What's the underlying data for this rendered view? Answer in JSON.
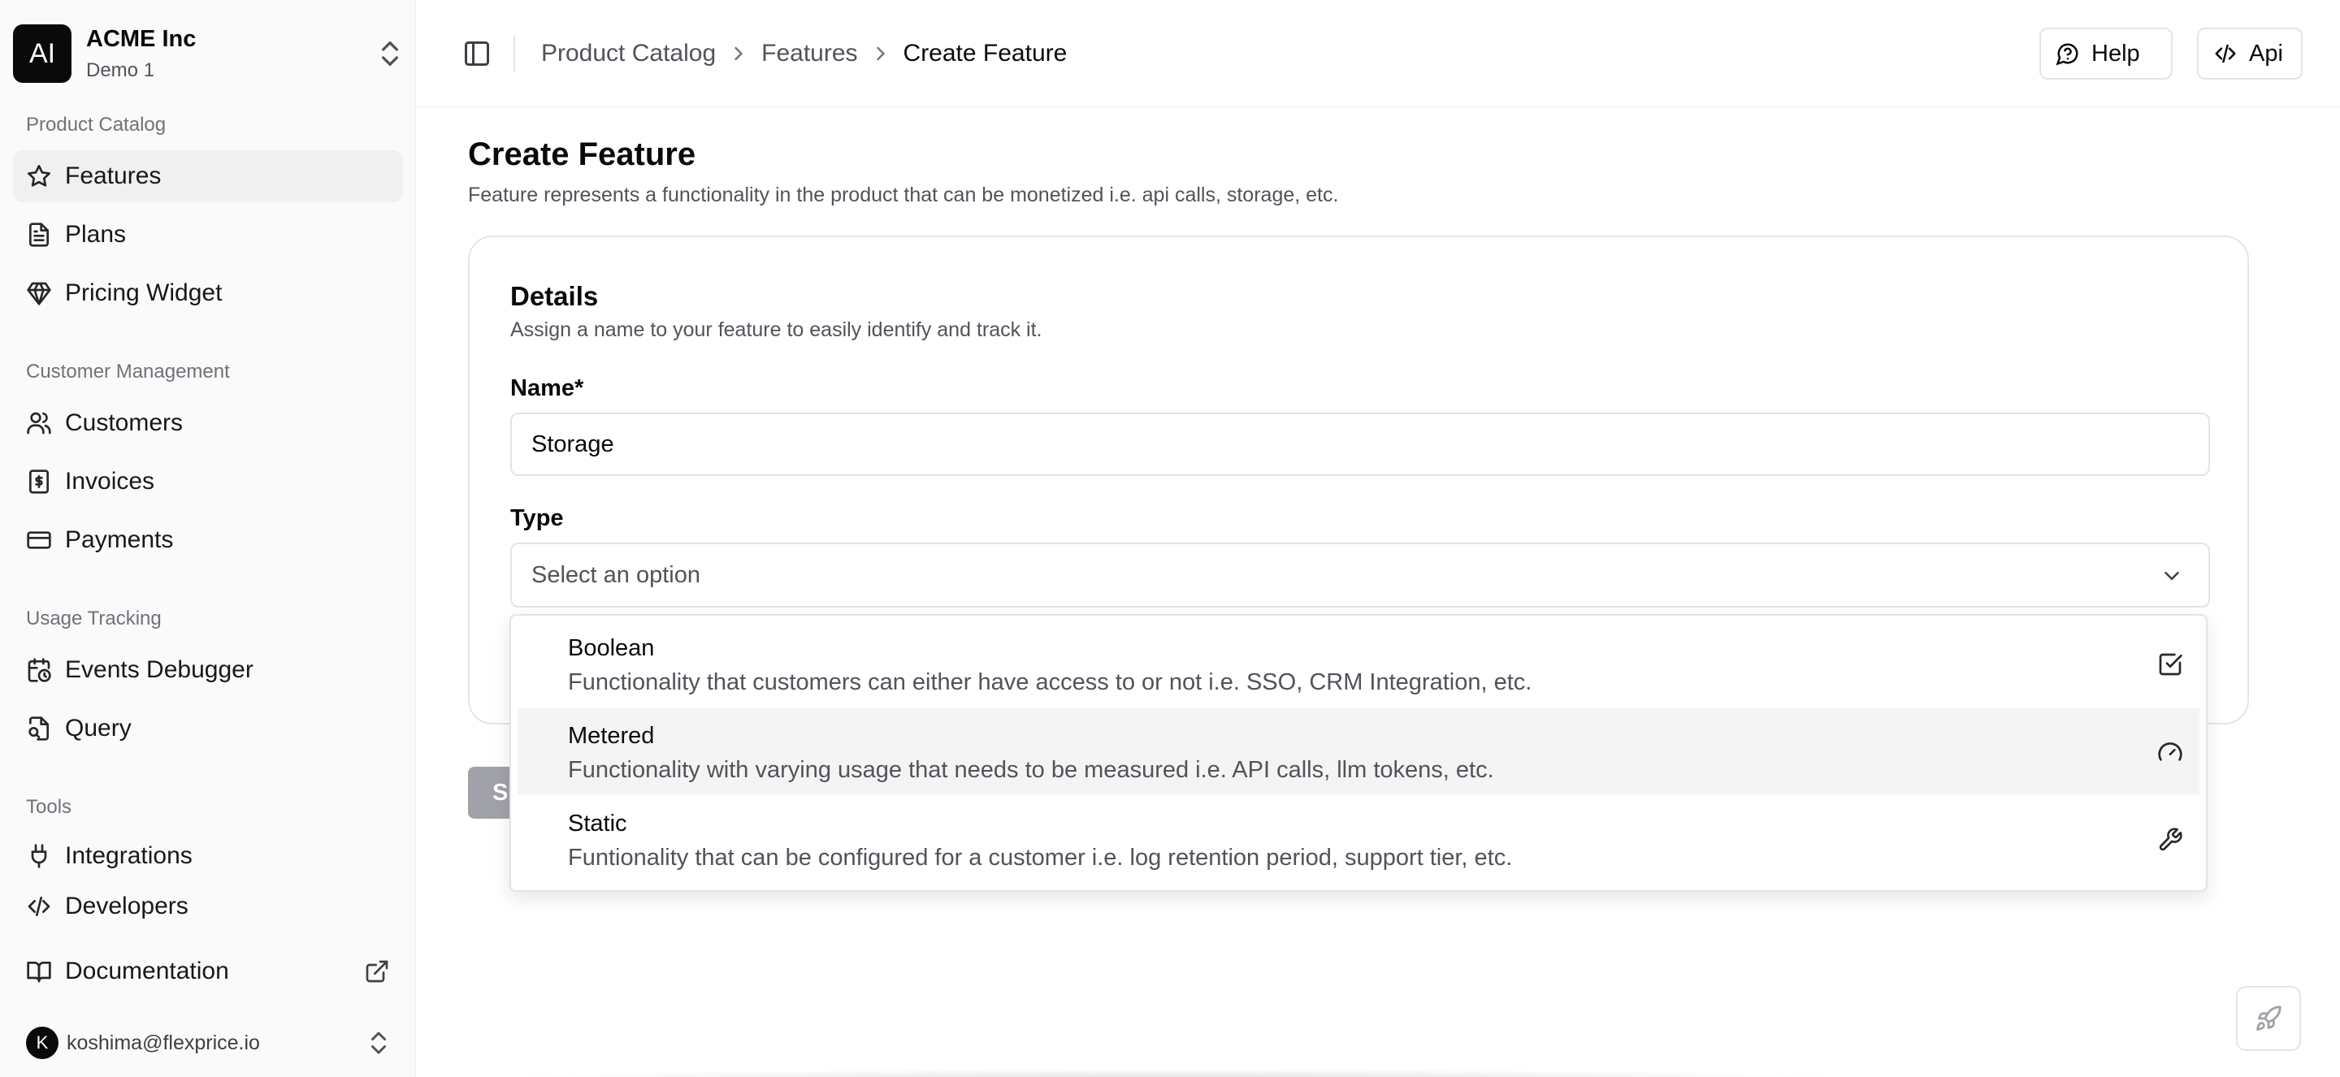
{
  "org": {
    "initials": "AI",
    "name": "ACME Inc",
    "env": "Demo 1"
  },
  "sidebar": {
    "sections": [
      {
        "label": "Product Catalog",
        "items": [
          {
            "label": "Features",
            "icon": "star-icon",
            "active": true
          },
          {
            "label": "Plans",
            "icon": "file-icon"
          },
          {
            "label": "Pricing Widget",
            "icon": "gem-icon"
          }
        ]
      },
      {
        "label": "Customer Management",
        "items": [
          {
            "label": "Customers",
            "icon": "users-icon"
          },
          {
            "label": "Invoices",
            "icon": "receipt-dollar-icon"
          },
          {
            "label": "Payments",
            "icon": "credit-card-icon"
          }
        ]
      },
      {
        "label": "Usage Tracking",
        "items": [
          {
            "label": "Events Debugger",
            "icon": "calendar-clock-icon"
          },
          {
            "label": "Query",
            "icon": "file-search-icon"
          }
        ]
      },
      {
        "label": "Tools",
        "items": [
          {
            "label": "Integrations",
            "icon": "plug-icon"
          },
          {
            "label": "Developers",
            "icon": "code-icon"
          }
        ]
      }
    ],
    "documentation": "Documentation"
  },
  "user": {
    "initial": "K",
    "email": "koshima@flexprice.io"
  },
  "header": {
    "breadcrumbs": [
      "Product Catalog",
      "Features",
      "Create Feature"
    ],
    "help_label": "Help",
    "api_label": "Api"
  },
  "page": {
    "title": "Create Feature",
    "subtitle": "Feature represents a functionality in the product that can be monetized i.e. api calls, storage, etc."
  },
  "details": {
    "title": "Details",
    "subtitle": "Assign a name to your feature to easily identify and track it.",
    "name_label": "Name*",
    "name_value": "Storage",
    "type_label": "Type",
    "type_placeholder": "Select an option"
  },
  "save_button_visible_text": "S",
  "type_options": [
    {
      "title": "Boolean",
      "description": "Functionality that customers can either have access to or not i.e. SSO, CRM Integration, etc.",
      "icon": "square-check-icon"
    },
    {
      "title": "Metered",
      "description": "Functionality with varying usage that needs to be measured i.e. API calls, llm tokens, etc.",
      "icon": "gauge-icon",
      "highlighted": true
    },
    {
      "title": "Static",
      "description": "Funtionality that can be configured for a customer i.e. log retention period, support tier, etc.",
      "icon": "wrench-icon"
    }
  ],
  "colors": {
    "accent": "#0a0a0a",
    "muted_text": "#52525b",
    "border": "#e4e4e7",
    "sidebar_bg": "#fafafa",
    "highlight_bg": "#f4f4f5"
  }
}
